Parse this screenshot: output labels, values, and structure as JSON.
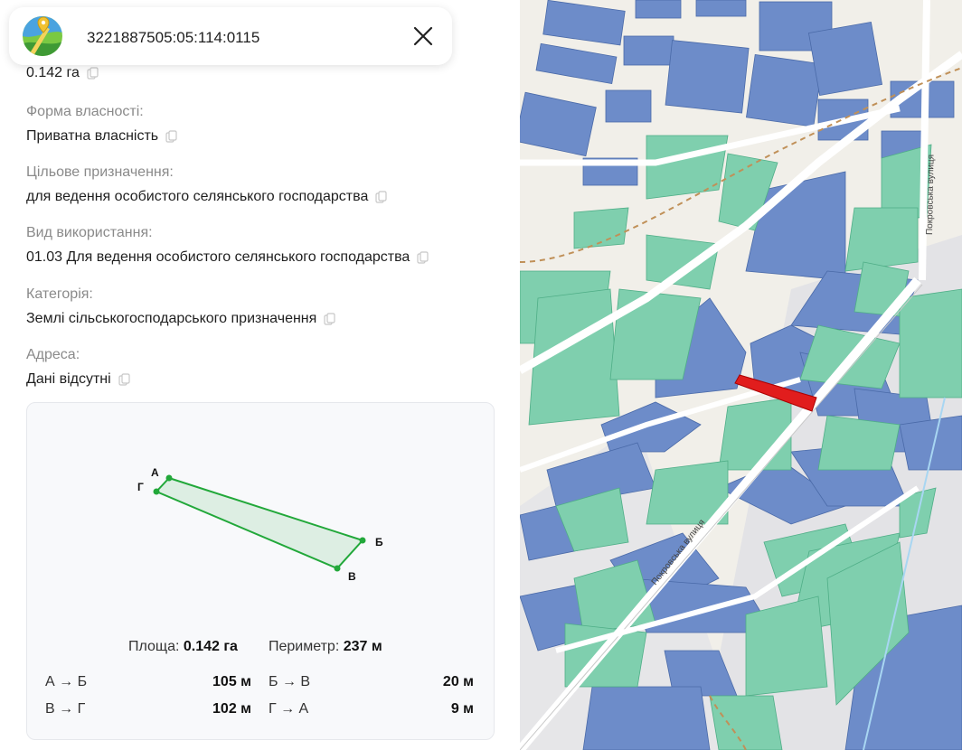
{
  "header": {
    "cadastral_number": "3221887505:05:114:0115"
  },
  "area_value": "0.142 га",
  "fields": [
    {
      "label": "Форма власності:",
      "value": "Приватна власність"
    },
    {
      "label": "Цільове призначення:",
      "value": "для ведення особистого селянського господарства"
    },
    {
      "label": "Вид використання:",
      "value": "01.03 Для ведення особистого селянського господарства"
    },
    {
      "label": "Категорія:",
      "value": "Землі сільськогосподарського призначення"
    },
    {
      "label": "Адреса:",
      "value": "Дані відсутні"
    }
  ],
  "shape": {
    "vertices": [
      "А",
      "Б",
      "В",
      "Г"
    ],
    "summary": {
      "area_label": "Площа:",
      "area_value": "0.142 га",
      "perimeter_label": "Периметр:",
      "perimeter_value": "237 м"
    },
    "sides": [
      {
        "name": "А → Б",
        "length": "105 м"
      },
      {
        "name": "Б → В",
        "length": "20 м"
      },
      {
        "name": "В → Г",
        "length": "102 м"
      },
      {
        "name": "Г → А",
        "length": "9 м"
      }
    ]
  },
  "map": {
    "street_label": "Покровська вулиця",
    "colors": {
      "parcel_blue": "#6d8cc9",
      "parcel_green": "#7fcfae",
      "selected_parcel": "#e11d1d",
      "road": "#ffffff",
      "background": "#f1efe9",
      "shape_stroke": "#22a83a"
    }
  }
}
